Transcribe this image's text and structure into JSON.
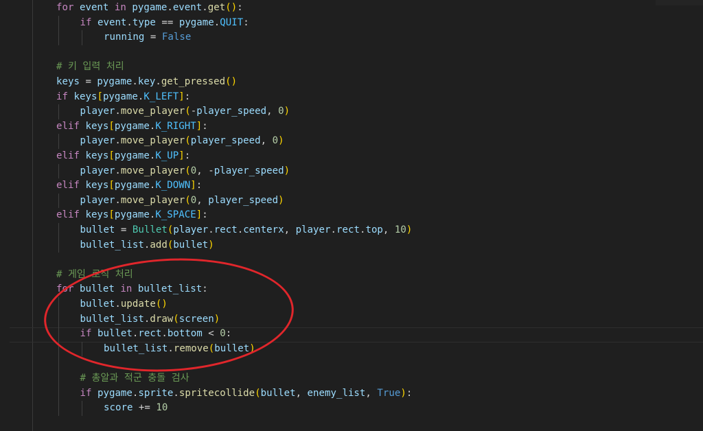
{
  "editor": {
    "lines": [
      [
        [
          "ctl",
          "for"
        ],
        [
          "op",
          " "
        ],
        [
          "var",
          "event"
        ],
        [
          "op",
          " "
        ],
        [
          "ctl",
          "in"
        ],
        [
          "op",
          " "
        ],
        [
          "var",
          "pygame"
        ],
        [
          "op",
          "."
        ],
        [
          "var",
          "event"
        ],
        [
          "op",
          "."
        ],
        [
          "fn",
          "get"
        ],
        [
          "b1",
          "()"
        ],
        [
          "op",
          ":"
        ]
      ],
      [
        [
          "ctl",
          "if"
        ],
        [
          "op",
          " "
        ],
        [
          "var",
          "event"
        ],
        [
          "op",
          "."
        ],
        [
          "var",
          "type"
        ],
        [
          "op",
          " == "
        ],
        [
          "var",
          "pygame"
        ],
        [
          "op",
          "."
        ],
        [
          "const",
          "QUIT"
        ],
        [
          "op",
          ":"
        ]
      ],
      [
        [
          "var",
          "running"
        ],
        [
          "op",
          " = "
        ],
        [
          "kw",
          "False"
        ]
      ],
      [],
      [
        [
          "cmt",
          "# 키 입력 처리"
        ]
      ],
      [
        [
          "var",
          "keys"
        ],
        [
          "op",
          " = "
        ],
        [
          "var",
          "pygame"
        ],
        [
          "op",
          "."
        ],
        [
          "var",
          "key"
        ],
        [
          "op",
          "."
        ],
        [
          "fn",
          "get_pressed"
        ],
        [
          "b1",
          "()"
        ]
      ],
      [
        [
          "ctl",
          "if"
        ],
        [
          "op",
          " "
        ],
        [
          "var",
          "keys"
        ],
        [
          "b1",
          "["
        ],
        [
          "var",
          "pygame"
        ],
        [
          "op",
          "."
        ],
        [
          "const",
          "K_LEFT"
        ],
        [
          "b1",
          "]"
        ],
        [
          "op",
          ":"
        ]
      ],
      [
        [
          "var",
          "player"
        ],
        [
          "op",
          "."
        ],
        [
          "fn",
          "move_player"
        ],
        [
          "b1",
          "("
        ],
        [
          "op",
          "-"
        ],
        [
          "var",
          "player_speed"
        ],
        [
          "op",
          ", "
        ],
        [
          "num",
          "0"
        ],
        [
          "b1",
          ")"
        ]
      ],
      [
        [
          "ctl",
          "elif"
        ],
        [
          "op",
          " "
        ],
        [
          "var",
          "keys"
        ],
        [
          "b1",
          "["
        ],
        [
          "var",
          "pygame"
        ],
        [
          "op",
          "."
        ],
        [
          "const",
          "K_RIGHT"
        ],
        [
          "b1",
          "]"
        ],
        [
          "op",
          ":"
        ]
      ],
      [
        [
          "var",
          "player"
        ],
        [
          "op",
          "."
        ],
        [
          "fn",
          "move_player"
        ],
        [
          "b1",
          "("
        ],
        [
          "var",
          "player_speed"
        ],
        [
          "op",
          ", "
        ],
        [
          "num",
          "0"
        ],
        [
          "b1",
          ")"
        ]
      ],
      [
        [
          "ctl",
          "elif"
        ],
        [
          "op",
          " "
        ],
        [
          "var",
          "keys"
        ],
        [
          "b1",
          "["
        ],
        [
          "var",
          "pygame"
        ],
        [
          "op",
          "."
        ],
        [
          "const",
          "K_UP"
        ],
        [
          "b1",
          "]"
        ],
        [
          "op",
          ":"
        ]
      ],
      [
        [
          "var",
          "player"
        ],
        [
          "op",
          "."
        ],
        [
          "fn",
          "move_player"
        ],
        [
          "b1",
          "("
        ],
        [
          "num",
          "0"
        ],
        [
          "op",
          ", -"
        ],
        [
          "var",
          "player_speed"
        ],
        [
          "b1",
          ")"
        ]
      ],
      [
        [
          "ctl",
          "elif"
        ],
        [
          "op",
          " "
        ],
        [
          "var",
          "keys"
        ],
        [
          "b1",
          "["
        ],
        [
          "var",
          "pygame"
        ],
        [
          "op",
          "."
        ],
        [
          "const",
          "K_DOWN"
        ],
        [
          "b1",
          "]"
        ],
        [
          "op",
          ":"
        ]
      ],
      [
        [
          "var",
          "player"
        ],
        [
          "op",
          "."
        ],
        [
          "fn",
          "move_player"
        ],
        [
          "b1",
          "("
        ],
        [
          "num",
          "0"
        ],
        [
          "op",
          ", "
        ],
        [
          "var",
          "player_speed"
        ],
        [
          "b1",
          ")"
        ]
      ],
      [
        [
          "ctl",
          "elif"
        ],
        [
          "op",
          " "
        ],
        [
          "var",
          "keys"
        ],
        [
          "b1",
          "["
        ],
        [
          "var",
          "pygame"
        ],
        [
          "op",
          "."
        ],
        [
          "const",
          "K_SPACE"
        ],
        [
          "b1",
          "]"
        ],
        [
          "op",
          ":"
        ]
      ],
      [
        [
          "var",
          "bullet"
        ],
        [
          "op",
          " = "
        ],
        [
          "cls",
          "Bullet"
        ],
        [
          "b1",
          "("
        ],
        [
          "var",
          "player"
        ],
        [
          "op",
          "."
        ],
        [
          "var",
          "rect"
        ],
        [
          "op",
          "."
        ],
        [
          "var",
          "centerx"
        ],
        [
          "op",
          ", "
        ],
        [
          "var",
          "player"
        ],
        [
          "op",
          "."
        ],
        [
          "var",
          "rect"
        ],
        [
          "op",
          "."
        ],
        [
          "var",
          "top"
        ],
        [
          "op",
          ", "
        ],
        [
          "num",
          "10"
        ],
        [
          "b1",
          ")"
        ]
      ],
      [
        [
          "var",
          "bullet_list"
        ],
        [
          "op",
          "."
        ],
        [
          "fn",
          "add"
        ],
        [
          "b1",
          "("
        ],
        [
          "var",
          "bullet"
        ],
        [
          "b1",
          ")"
        ]
      ],
      [],
      [
        [
          "cmt",
          "# 게임 로직 처리"
        ]
      ],
      [
        [
          "ctl",
          "for"
        ],
        [
          "op",
          " "
        ],
        [
          "var",
          "bullet"
        ],
        [
          "op",
          " "
        ],
        [
          "ctl",
          "in"
        ],
        [
          "op",
          " "
        ],
        [
          "var",
          "bullet_list"
        ],
        [
          "op",
          ":"
        ]
      ],
      [
        [
          "var",
          "bullet"
        ],
        [
          "op",
          "."
        ],
        [
          "fn",
          "update"
        ],
        [
          "b1",
          "()"
        ]
      ],
      [
        [
          "var",
          "bullet_list"
        ],
        [
          "op",
          "."
        ],
        [
          "fn",
          "draw"
        ],
        [
          "b1",
          "("
        ],
        [
          "var",
          "screen"
        ],
        [
          "b1",
          ")"
        ]
      ],
      [
        [
          "ctl",
          "if"
        ],
        [
          "op",
          " "
        ],
        [
          "var",
          "bullet"
        ],
        [
          "op",
          "."
        ],
        [
          "var",
          "rect"
        ],
        [
          "op",
          "."
        ],
        [
          "var",
          "bottom"
        ],
        [
          "op",
          " < "
        ],
        [
          "num",
          "0"
        ],
        [
          "op",
          ":"
        ]
      ],
      [
        [
          "var",
          "bullet_list"
        ],
        [
          "op",
          "."
        ],
        [
          "fn",
          "remove"
        ],
        [
          "b1",
          "("
        ],
        [
          "var",
          "bullet"
        ],
        [
          "b1",
          ")"
        ]
      ],
      [],
      [
        [
          "cmt",
          "# 총알과 적군 충돌 검사"
        ]
      ],
      [
        [
          "ctl",
          "if"
        ],
        [
          "op",
          " "
        ],
        [
          "var",
          "pygame"
        ],
        [
          "op",
          "."
        ],
        [
          "var",
          "sprite"
        ],
        [
          "op",
          "."
        ],
        [
          "fn",
          "spritecollide"
        ],
        [
          "b1",
          "("
        ],
        [
          "var",
          "bullet"
        ],
        [
          "op",
          ", "
        ],
        [
          "var",
          "enemy_list"
        ],
        [
          "op",
          ", "
        ],
        [
          "kw",
          "True"
        ],
        [
          "b1",
          ")"
        ],
        [
          "op",
          ":"
        ]
      ],
      [
        [
          "var",
          "score"
        ],
        [
          "op",
          " += "
        ],
        [
          "num",
          "10"
        ]
      ]
    ]
  },
  "annotation": {
    "shape": "red-ellipse",
    "color": "#e0262b"
  }
}
